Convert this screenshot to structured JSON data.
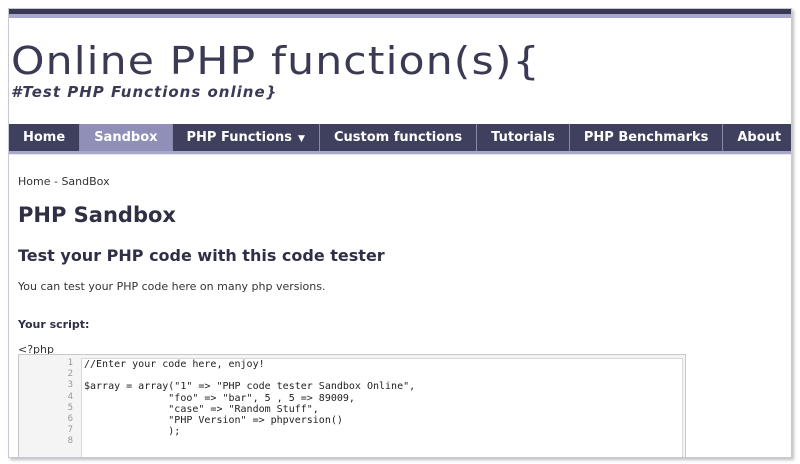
{
  "site": {
    "title": "Online PHP function(s){",
    "tagline": "#Test PHP Functions online}"
  },
  "nav": {
    "items": [
      {
        "label": "Home",
        "active": false
      },
      {
        "label": "Sandbox",
        "active": true
      },
      {
        "label": "PHP Functions",
        "active": false,
        "dropdown": true
      },
      {
        "label": "Custom functions",
        "active": false
      },
      {
        "label": "Tutorials",
        "active": false
      },
      {
        "label": "PHP Benchmarks",
        "active": false
      },
      {
        "label": "About",
        "active": false
      }
    ]
  },
  "breadcrumb": {
    "home": "Home",
    "separator": " - ",
    "current": "SandBox"
  },
  "page": {
    "title": "PHP Sandbox",
    "subtitle": "Test your PHP code with this code tester",
    "intro": "You can test your PHP code here on many php versions.",
    "script_label": "Your script:",
    "php_open": "<?php"
  },
  "editor": {
    "line_numbers": [
      "1",
      "2",
      "3",
      "4",
      "5",
      "6",
      "7",
      "8"
    ],
    "lines": [
      "//Enter your code here, enjoy!",
      "",
      "$array = array(\"1\" => \"PHP code tester Sandbox Online\",",
      "              \"foo\" => \"bar\", 5 , 5 => 89009,",
      "              \"case\" => \"Random Stuff\",",
      "              \"PHP Version\" => phpversion()",
      "              );",
      ""
    ]
  },
  "colors": {
    "primary": "#3f3f5e",
    "accent": "#8f8fb8",
    "text": "#2f2f45"
  }
}
